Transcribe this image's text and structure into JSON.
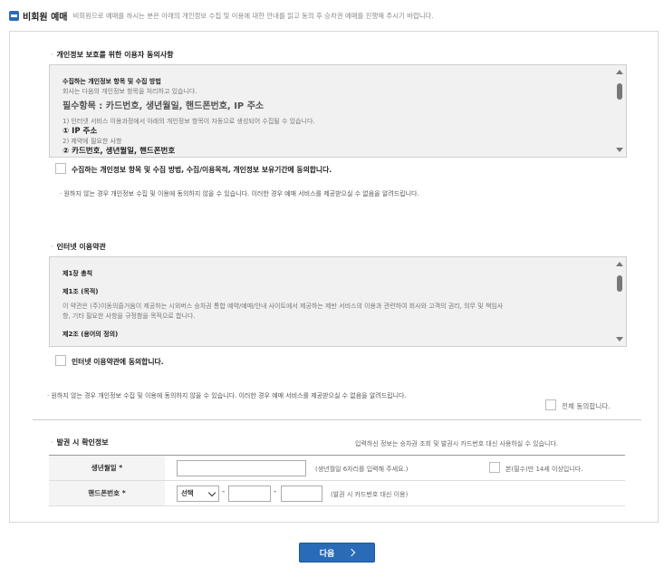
{
  "header": {
    "title": "비회원 예매",
    "description": "비회원으로 예매를 하시는 분은 아래의 개인정보 수집 및 이용에 대한 안내를 읽고 동의 후 승차권 예매를 진행해 주시기 바랍니다."
  },
  "privacy": {
    "section_title": "개인정보 보호를 위한 이용자 동의사항",
    "lines": [
      "수집하는 개인정보 항목 및 수집 방법",
      "회사는 다음의 개인정보 항목을 처리하고 있습니다.",
      "필수항목 : 카드번호, 생년월일, 핸드폰번호, IP 주소",
      "1) 인터넷 서비스 이용과정에서 아래의 개인정보 항목이 자동으로 생성되어 수집될 수 있습니다.",
      "① IP 주소",
      "2) 제약에 필요한 사항",
      "② 카드번호, 생년월일, 핸드폰번호"
    ],
    "agree_label": "수집하는 개인정보 항목 및 수집 방법, 수집/이용목적, 개인정보 보유기간에 동의합니다.",
    "refusal_note": "원하지 않는 경우 개인정보 수집 및 이용에 동의하지 않을 수 있습니다. 이러한 경우 예매 서비스를 제공받으실 수 없음을 알려드립니다."
  },
  "terms": {
    "section_title": "인터넷 이용약관",
    "lines": [
      "제1장 총칙",
      "제1조 (목적)",
      "이 약관은 (주)이동의즐거움이 제공하는 시외버스 승차권 통합 예약/예매/안내 사이트에서 제공하는 제반 서비스의 이용과 관련하여 회사와 고객의 권리, 의무 및 책임사",
      "항, 기타 필요한 사항을 규정함을 목적으로 합니다.",
      "제2조 (용어의 정의)"
    ],
    "agree_label": "인터넷 이용약관에 동의합니다.",
    "refusal_note": "원하지 않는 경우 개인정보 수집 및 이용에 동의하지 않을 수 있습니다. 이러한 경우 예매 서비스를 제공받으실 수 없음을 알려드립니다.",
    "agree_all_label": "전체 동의합니다."
  },
  "verification": {
    "section_title": "발권 시 확인정보",
    "notice": "입력하신 정보는 승차권 조회 및 발권시 카드번호 대신 사용하실 수 있습니다.",
    "birth_label": "생년월일 *",
    "birth_value": "",
    "birth_hint": "(생년월일 6자리를 입력해 주세요.)",
    "age_check_label": "본(필수)만 14세 이상입니다.",
    "phone_label": "핸드폰번호 *",
    "phone_select": "선택",
    "phone_mid": "",
    "phone_last": "",
    "phone_hint": "(발권 시 카드번호 대신 이용)"
  },
  "buttons": {
    "next_label": "다음"
  },
  "colors": {
    "accent": "#2a6bb8"
  }
}
